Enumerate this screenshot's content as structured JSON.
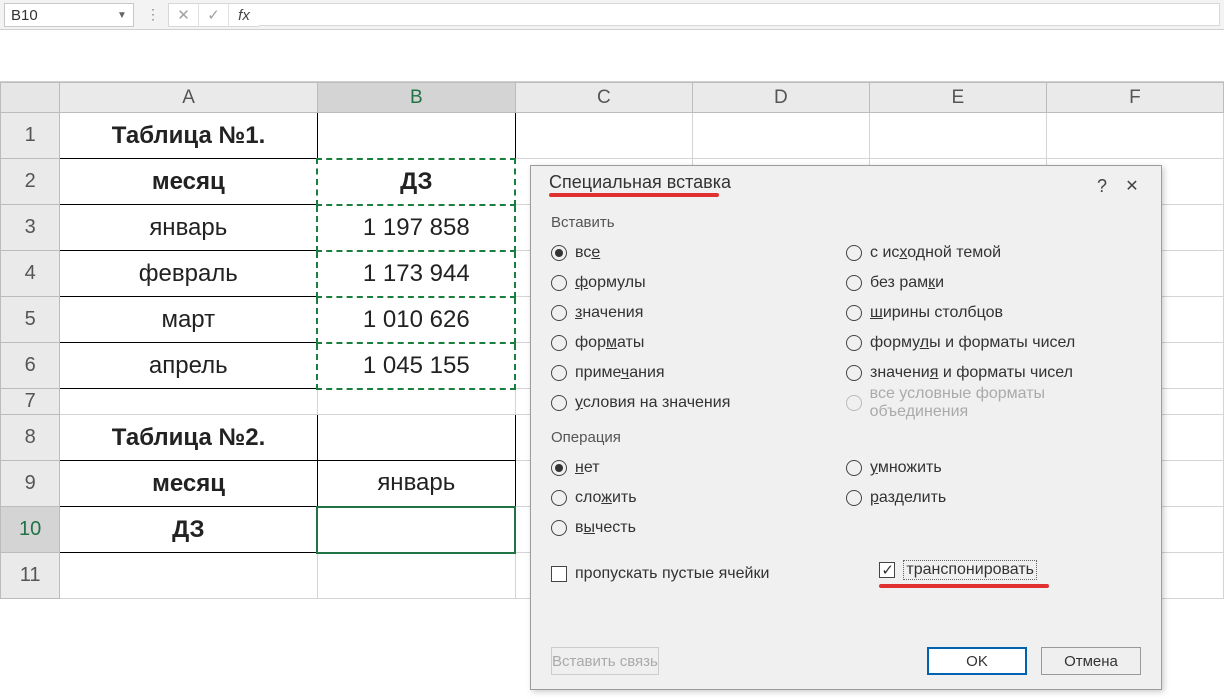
{
  "namebox": {
    "value": "B10"
  },
  "formula_bar": {
    "cancel_icon": "✕",
    "accept_icon": "✓",
    "fx_icon": "fx"
  },
  "columns": [
    "A",
    "B",
    "C",
    "D",
    "E",
    "F"
  ],
  "rows": [
    "1",
    "2",
    "3",
    "4",
    "5",
    "6",
    "7",
    "8",
    "9",
    "10",
    "11"
  ],
  "data": {
    "A1": "Таблица №1.",
    "A2": "месяц",
    "B2": "ДЗ",
    "A3": "январь",
    "B3": "1 197 858",
    "A4": "февраль",
    "B4": "1 173 944",
    "A5": "март",
    "B5": "1 010 626",
    "A6": "апрель",
    "B6": "1 045 155",
    "A8": "Таблица №2.",
    "A9": "месяц",
    "B9": "январь",
    "A10": "ДЗ"
  },
  "selected_cell": "B10",
  "marching_ants_range": "B2:B6",
  "dialog": {
    "title": "Специальная вставка",
    "help": "?",
    "close": "✕",
    "group_paste": "Вставить",
    "group_operation": "Операция",
    "paste_options_left": [
      {
        "id": "all",
        "label": "все",
        "label_html": "вс<span class='u'>е</span>",
        "selected": true
      },
      {
        "id": "formulas",
        "label": "формулы",
        "label_html": "<span class='u'>ф</span>ормулы"
      },
      {
        "id": "values",
        "label": "значения",
        "label_html": "<span class='u'>з</span>начения"
      },
      {
        "id": "formats",
        "label": "форматы",
        "label_html": "фор<span class='u'>м</span>аты"
      },
      {
        "id": "comments",
        "label": "примечания",
        "label_html": "приме<span class='u'>ч</span>ания"
      },
      {
        "id": "validation",
        "label": "условия на значения",
        "label_html": "<span class='u'>у</span>словия на значения"
      }
    ],
    "paste_options_right": [
      {
        "id": "theme",
        "label": "с исходной темой",
        "label_html": "с ис<span class='u'>х</span>одной темой"
      },
      {
        "id": "noborder",
        "label": "без рамки",
        "label_html": "без рам<span class='u'>к</span>и"
      },
      {
        "id": "colwidths",
        "label": "ширины столбцов",
        "label_html": "<span class='u'>ш</span>ирины столбцов"
      },
      {
        "id": "formulas_num",
        "label": "формулы и форматы чисел",
        "label_html": "форму<span class='u'>л</span>ы и форматы чисел"
      },
      {
        "id": "values_num",
        "label": "значения и форматы чисел",
        "label_html": "значени<span class='u'>я</span> и форматы чисел"
      },
      {
        "id": "all_merge",
        "label": "все условные форматы объединения",
        "disabled": true
      }
    ],
    "op_options_left": [
      {
        "id": "none",
        "label": "нет",
        "label_html": "<span class='u'>н</span>ет",
        "selected": true
      },
      {
        "id": "add",
        "label": "сложить",
        "label_html": "сло<span class='u'>ж</span>ить"
      },
      {
        "id": "sub",
        "label": "вычесть",
        "label_html": "в<span class='u'>ы</span>честь"
      }
    ],
    "op_options_right": [
      {
        "id": "mul",
        "label": "умножить",
        "label_html": "<span class='u'>у</span>множить"
      },
      {
        "id": "div",
        "label": "разделить",
        "label_html": "<span class='u'>р</span>азделить"
      }
    ],
    "skip_blanks_label": "пропускать пустые ячейки",
    "transpose_label": "транспонировать",
    "transpose_checked": true,
    "btn_paste_link": "Вставить связь",
    "btn_ok": "OK",
    "btn_cancel": "Отмена"
  }
}
